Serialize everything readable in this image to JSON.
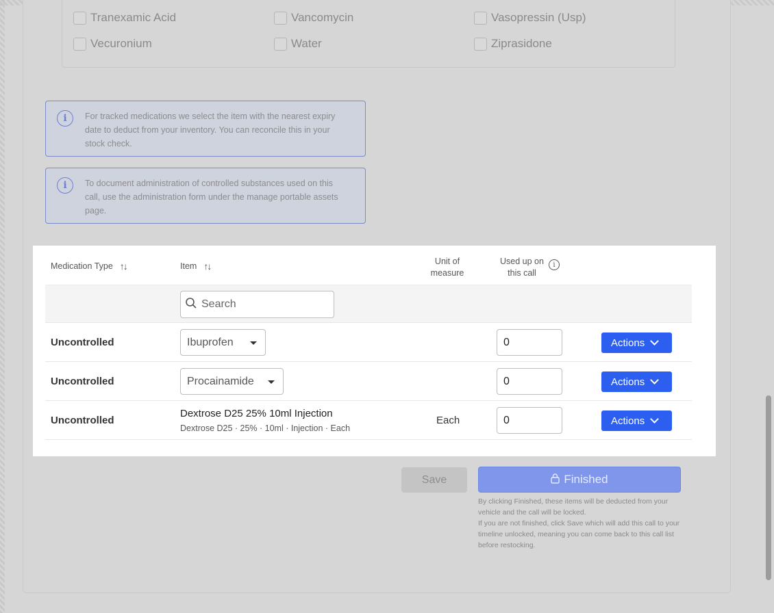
{
  "checkboxes": [
    {
      "label": "Tranexamic Acid"
    },
    {
      "label": "Vancomycin"
    },
    {
      "label": "Vasopressin (Usp)"
    },
    {
      "label": "Vecuronium"
    },
    {
      "label": "Water"
    },
    {
      "label": "Ziprasidone"
    }
  ],
  "info": [
    {
      "icon": "info-icon",
      "glyph": "i",
      "text": "For tracked medications we select the item with the nearest expiry date to deduct from your inventory. You can reconcile this in your stock check."
    },
    {
      "icon": "info-icon",
      "glyph": "i",
      "text": "To document administration of controlled substances used on this call, use the administration form under the manage portable assets page."
    }
  ],
  "table": {
    "headers": {
      "medication_type": "Medication Type",
      "item": "Item",
      "unit_line1": "Unit of",
      "unit_line2": "measure",
      "used_line1": "Used up on",
      "used_line2": "this call"
    },
    "search_placeholder": "Search",
    "rows": [
      {
        "type": "Uncontrolled",
        "item_select": "Ibuprofen",
        "qty": "0",
        "actions": "Actions"
      },
      {
        "type": "Uncontrolled",
        "item_select": "Procainamide",
        "qty": "0",
        "actions": "Actions"
      },
      {
        "type": "Uncontrolled",
        "item_name": "Dextrose D25 25% 10ml Injection",
        "item_detail": "Dextrose D25 · 25% · 10ml · Injection · Each",
        "unit": "Each",
        "qty": "0",
        "actions": "Actions"
      }
    ]
  },
  "footer": {
    "save_label": "Save",
    "finished_label": "Finished",
    "note_line1": "By clicking Finished, these items will be deducted from your vehicle and the call will be locked.",
    "note_line2": "If you are not finished, click Save which will add this call to your timeline unlocked, meaning you can come back to this call list before restocking."
  },
  "colors": {
    "primary": "#2c5ef0",
    "finished_bg": "#7f96ea",
    "info_border": "#7b8bc7"
  }
}
